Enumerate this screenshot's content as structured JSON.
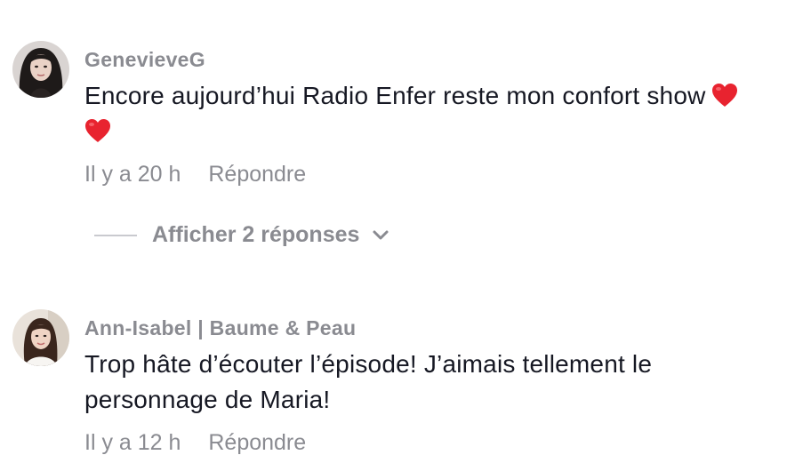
{
  "comments": [
    {
      "username": "GenevieveG",
      "text_line1": "Encore aujourd’hui Radio Enfer reste mon confort show",
      "emoji": "heart-emoji",
      "time": "Il y a 20 h",
      "reply_label": "Répondre",
      "show_replies_label": "Afficher 2 réponses"
    },
    {
      "username": "Ann-Isabel | Baume & Peau",
      "text_line1": "Trop hâte d’écouter l’épisode! J’aimais tellement le",
      "text_line2": "personnage de Maria!",
      "time": "Il y a 12 h",
      "reply_label": "Répondre"
    }
  ],
  "colors": {
    "heart": "#e8232f",
    "muted_text": "#8a8b91",
    "body_text": "#161823"
  }
}
